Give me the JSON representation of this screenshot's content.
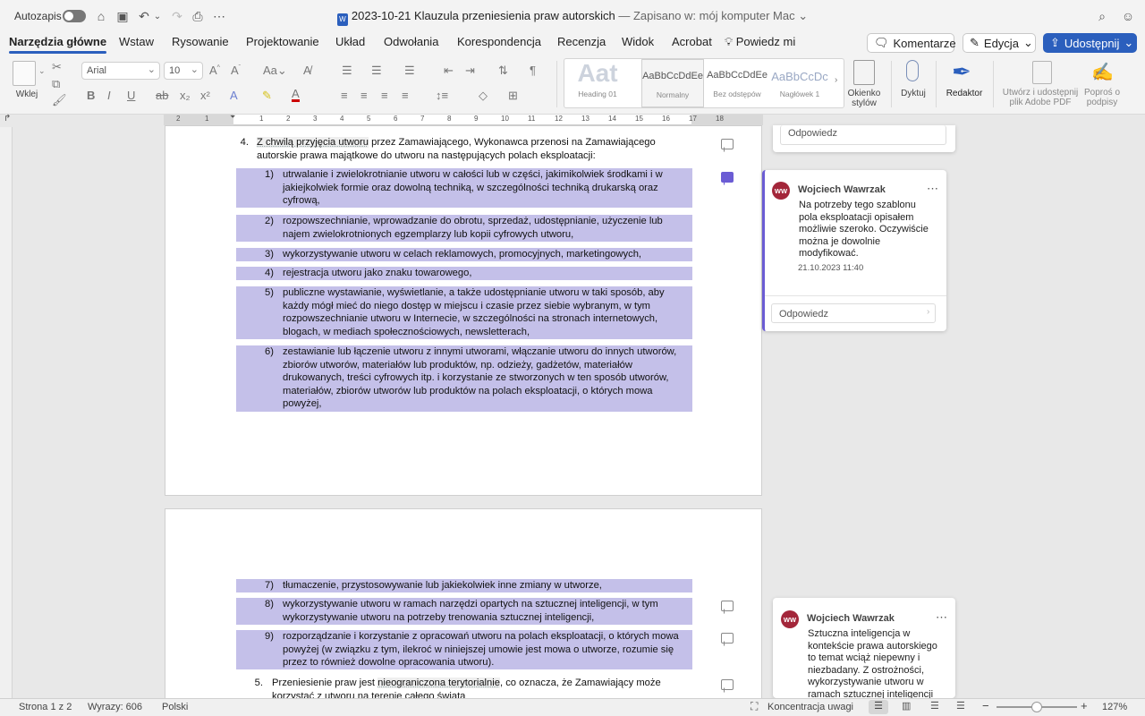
{
  "titlebar": {
    "autosave_label": "Autozapis",
    "doc_title": "2023-10-21 Klauzula przeniesienia praw autorskich",
    "saved_status": "— Zapisano w: mój komputer Mac"
  },
  "tabs": [
    "Narzędzia główne",
    "Wstaw",
    "Rysowanie",
    "Projektowanie",
    "Układ",
    "Odwołania",
    "Korespondencja",
    "Recenzja",
    "Widok",
    "Acrobat"
  ],
  "tell_me": "Powiedz mi",
  "actions": {
    "comments": "Komentarze",
    "editing": "Edycja",
    "share": "Udostępnij"
  },
  "ribbon": {
    "paste": "Wklej",
    "font_name": "Arial",
    "font_size": "10",
    "styles": [
      {
        "sample": "Aat",
        "name": "Heading 01"
      },
      {
        "sample": "AaBbCcDdEe",
        "name": "Normalny"
      },
      {
        "sample": "AaBbCcDdEe",
        "name": "Bez odstępów"
      },
      {
        "sample": "AaBbCcDc",
        "name": "Nagłówek 1"
      }
    ],
    "styles_pane": [
      "Okienko",
      "stylów"
    ],
    "dictate": "Dyktuj",
    "editor": "Redaktor",
    "adobe": [
      "Utwórz i udostępnij",
      "plik Adobe PDF"
    ],
    "signatures": [
      "Poproś o",
      "podpisy"
    ]
  },
  "ruler": [
    "2",
    "1",
    "1",
    "2",
    "3",
    "4",
    "5",
    "6",
    "7",
    "8",
    "9",
    "10",
    "11",
    "12",
    "13",
    "14",
    "15",
    "16",
    "17",
    "18"
  ],
  "page1": {
    "item4_num": "4.",
    "item4_hl": "Z chwilą przyjęcia utworu",
    "item4_rest": " przez Zamawiającego, Wykonawca przenosi na Zamawiającego",
    "item4_line2": "autorskie prawa majątkowe do utworu na następujących polach eksploatacji:",
    "subitems": [
      {
        "num": "1)",
        "lines": [
          "utrwalanie i zwielokrotnianie utworu w całości lub w części, jakimikolwiek środkami i w",
          "jakiejkolwiek formie oraz dowolną techniką, w szczególności techniką drukarską oraz",
          "cyfrową,"
        ]
      },
      {
        "num": "2)",
        "lines": [
          "rozpowszechnianie, wprowadzanie do obrotu, sprzedaż, udostępnianie, użyczenie lub",
          "najem zwielokrotnionych egzemplarzy lub kopii cyfrowych utworu,"
        ]
      },
      {
        "num": "3)",
        "lines": [
          "wykorzystywanie utworu w celach reklamowych, promocyjnych, marketingowych,"
        ]
      },
      {
        "num": "4)",
        "lines": [
          "rejestracja utworu jako znaku towarowego,"
        ]
      },
      {
        "num": "5)",
        "lines": [
          "publiczne wystawianie, wyświetlanie, a także udostępnianie utworu w taki sposób, aby",
          "każdy mógł mieć do niego dostęp w miejscu i czasie przez siebie wybranym, w tym",
          "rozpowszechnianie utworu w Internecie, w szczególności na stronach internetowych,",
          "blogach, w mediach społecznościowych, newsletterach,"
        ]
      },
      {
        "num": "6)",
        "lines": [
          "zestawianie lub łączenie utworu z innymi utworami, włączanie utworu do innych utworów,",
          "zbiorów utworów, materiałów lub produktów, np. odzieży, gadżetów, materiałów",
          "drukowanych, treści cyfrowych itp. i korzystanie ze stworzonych w ten sposób utworów,",
          "materiałów, zbiorów utworów lub produktów na polach eksploatacji, o których mowa",
          "powyżej,"
        ]
      }
    ]
  },
  "page2": {
    "subitems": [
      {
        "num": "7)",
        "lines": [
          "tłumaczenie, przystosowywanie lub jakiekolwiek inne zmiany w utworze,"
        ]
      },
      {
        "num": "8)",
        "lines": [
          "wykorzystywanie utworu w ramach narzędzi opartych na sztucznej inteligencji, w tym",
          "wykorzystywanie utworu na potrzeby trenowania sztucznej inteligencji,"
        ]
      },
      {
        "num": "9)",
        "lines": [
          "rozporządzanie i korzystanie z opracowań utworu na polach eksploatacji, o których mowa",
          "powyżej (w związku z tym, ilekroć w niniejszej umowie jest mowa o utworze, rozumie się",
          "przez to również dowolne opracowania utworu)."
        ]
      }
    ],
    "item5_num": "5.",
    "item5_a": "Przeniesienie praw jest ",
    "item5_hl": "nieograniczona terytorialnie",
    "item5_b": ", co oznacza, że Zamawiający może",
    "item5_line2": "korzystać z utworu na terenie całego świata"
  },
  "comments": {
    "reply_top": "Odpowiedz",
    "card1": {
      "initials": "WW",
      "author": "Wojciech Wawrzak",
      "lines": [
        "Na potrzeby tego szablonu",
        "pola eksploatacji opisałem",
        "możliwie szeroko. Oczywiście",
        "można je dowolnie",
        "modyfikować."
      ],
      "date": "21.10.2023 11:40",
      "reply": "Odpowiedz"
    },
    "card2": {
      "initials": "WW",
      "author": "Wojciech Wawrzak",
      "lines": [
        "Sztuczna inteligencja w",
        "kontekście prawa autorskiego",
        "to temat wciąż niepewny i",
        "niezbadany. Z ostrożności,",
        "wykorzystywanie utworu w",
        "ramach sztucznej inteligencji"
      ]
    }
  },
  "statusbar": {
    "page": "Strona 1 z 2",
    "words": "Wyrazy: 606",
    "language": "Polski",
    "focus": "Koncentracja uwagi",
    "zoom": "127%",
    "zoom_fraction": 0.5
  }
}
